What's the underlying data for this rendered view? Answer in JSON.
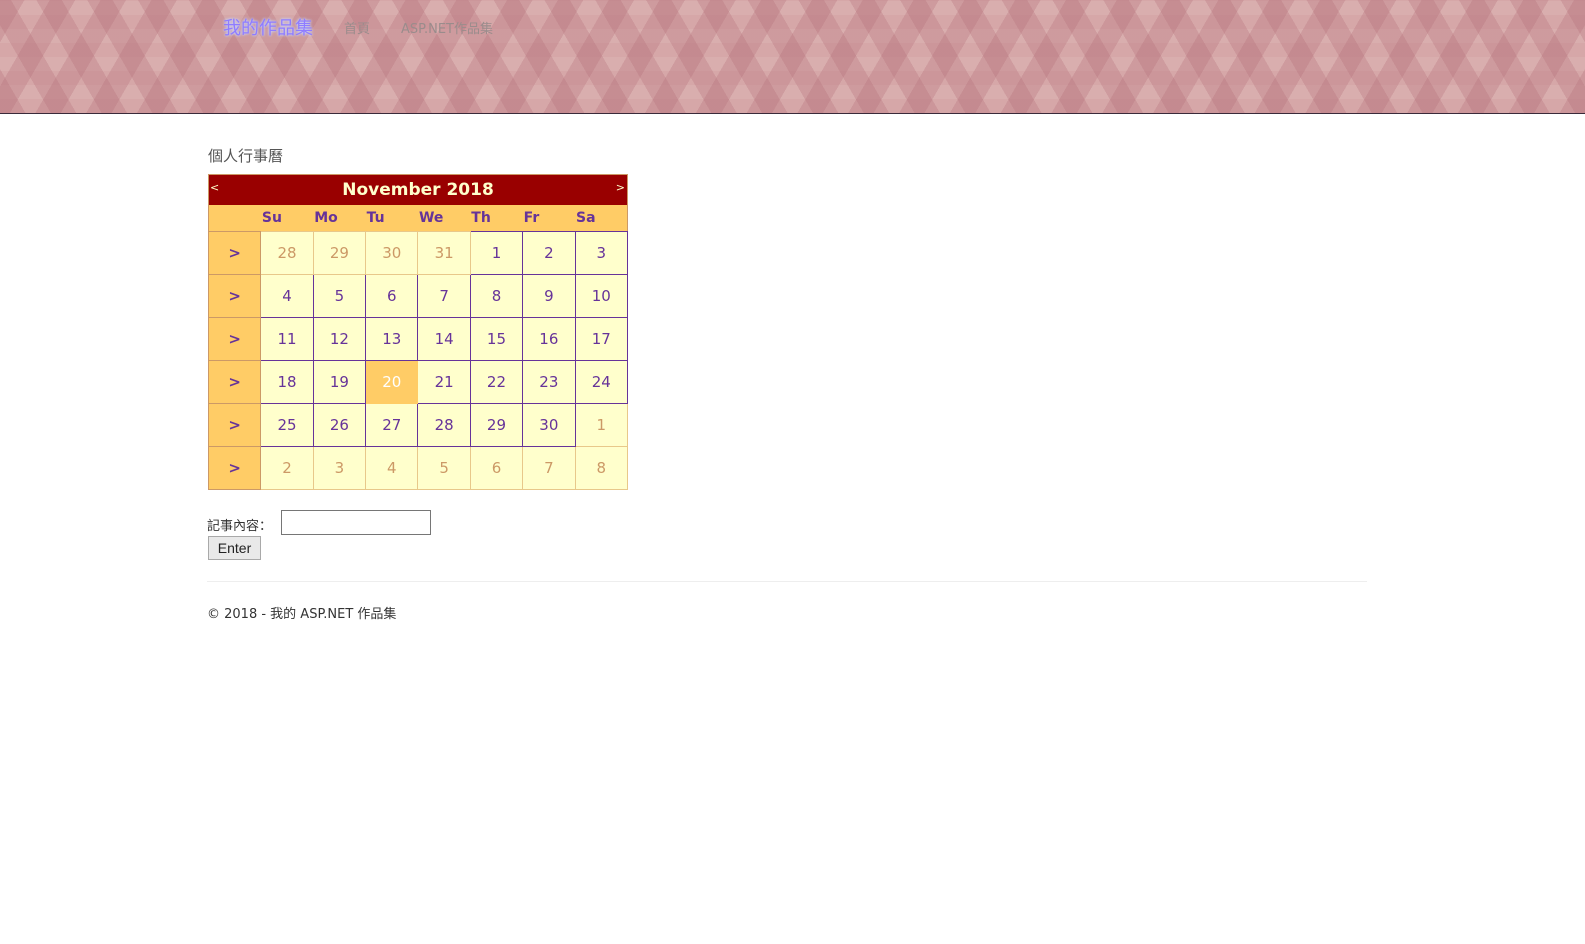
{
  "nav": {
    "brand": "我的作品集",
    "links": [
      "首頁",
      "ASP.NET作品集"
    ]
  },
  "page": {
    "heading": "個人行事曆"
  },
  "calendar": {
    "prev_label": "<",
    "next_label": ">",
    "title": "November 2018",
    "day_names": [
      "Su",
      "Mo",
      "Tu",
      "We",
      "Th",
      "Fr",
      "Sa"
    ],
    "week_selector_label": ">",
    "weeks": [
      [
        "28",
        "29",
        "30",
        "31",
        "1",
        "2",
        "3"
      ],
      [
        "4",
        "5",
        "6",
        "7",
        "8",
        "9",
        "10"
      ],
      [
        "11",
        "12",
        "13",
        "14",
        "15",
        "16",
        "17"
      ],
      [
        "18",
        "19",
        "20",
        "21",
        "22",
        "23",
        "24"
      ],
      [
        "25",
        "26",
        "27",
        "28",
        "29",
        "30",
        "1"
      ],
      [
        "2",
        "3",
        "4",
        "5",
        "6",
        "7",
        "8"
      ]
    ],
    "selected_day": "20",
    "colors": {
      "title_bg": "#990000",
      "title_text": "#ffffcc",
      "header_bg": "#ffcc66",
      "day_bg": "#ffffcc",
      "day_text": "#663399",
      "other_month_text": "#cc9966",
      "selected_bg": "#ffcc66"
    }
  },
  "form": {
    "memo_label": "記事內容：",
    "memo_value": "",
    "enter_label": "Enter"
  },
  "footer": {
    "text": "© 2018 - 我的 ASP.NET 作品集"
  }
}
